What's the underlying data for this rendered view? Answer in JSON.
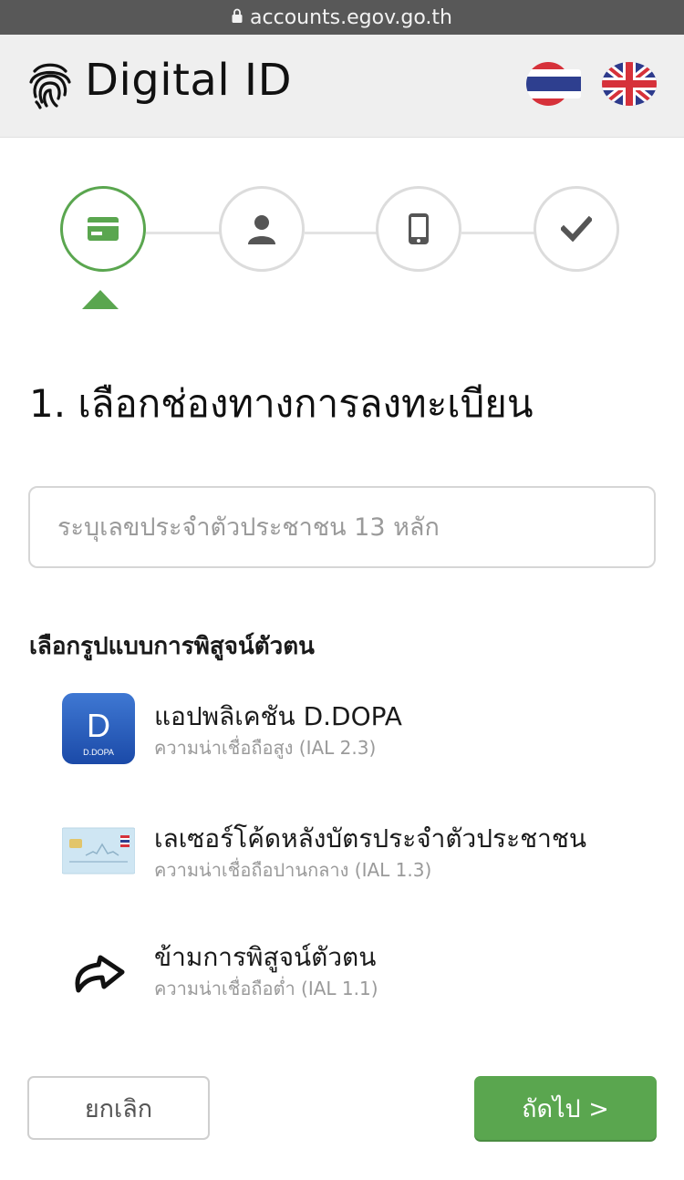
{
  "browser": {
    "url": "accounts.egov.go.th"
  },
  "header": {
    "title": "Digital ID",
    "languages": [
      {
        "code": "th",
        "icon": "thailand-flag-icon"
      },
      {
        "code": "en",
        "icon": "uk-flag-icon"
      }
    ]
  },
  "stepper": {
    "active_step": 1,
    "steps": [
      {
        "icon": "id-card-icon"
      },
      {
        "icon": "person-icon"
      },
      {
        "icon": "mobile-phone-icon"
      },
      {
        "icon": "checkmark-icon"
      }
    ]
  },
  "page": {
    "title": "1. เลือกช่องทางการลงทะเบียน"
  },
  "id_input": {
    "placeholder": "ระบุเลขประจำตัวประชาชน 13 หลัก",
    "value": ""
  },
  "verification": {
    "label": "เลือกรูปแบบการพิสูจน์ตัวตน",
    "options": [
      {
        "title": "แอปพลิเคชัน D.DOPA",
        "subtitle": "ความน่าเชื่อถือสูง (IAL 2.3)",
        "icon_text": "D",
        "icon_caption": "D.DOPA"
      },
      {
        "title": "เลเซอร์โค้ดหลังบัตรประจำตัวประชาชน",
        "subtitle": "ความน่าเชื่อถือปานกลาง (IAL 1.3)"
      },
      {
        "title": "ข้ามการพิสูจน์ตัวตน",
        "subtitle": "ความน่าเชื่อถือต่ำ (IAL 1.1)"
      }
    ]
  },
  "actions": {
    "cancel_label": "ยกเลิก",
    "next_label": "ถัดไป >"
  },
  "colors": {
    "accent": "#5aa64f",
    "header_bg": "#efefef",
    "url_bar": "#585858"
  }
}
